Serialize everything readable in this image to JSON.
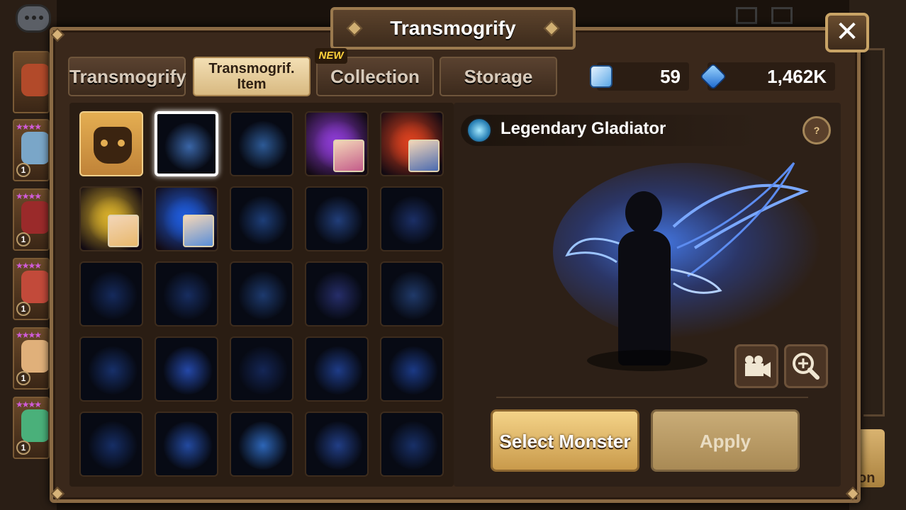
{
  "window": {
    "title": "Transmogrify",
    "close_label": "✕"
  },
  "tabs": [
    {
      "label": "Transmogrify",
      "active": false
    },
    {
      "label": "Transmogrif. Item",
      "active": true
    },
    {
      "label": "Collection",
      "active": false,
      "badge": "NEW"
    },
    {
      "label": "Storage",
      "active": false
    }
  ],
  "currency": {
    "transmogrify_stone": "59",
    "crystals": "1,462K"
  },
  "side_monsters": [
    {
      "stars": "★★★★",
      "level": "1"
    },
    {
      "stars": "★★★★",
      "level": "1"
    },
    {
      "stars": "★★★★",
      "level": "1"
    },
    {
      "stars": "★★★★",
      "level": "1"
    },
    {
      "stars": "★★★★",
      "level": "1"
    }
  ],
  "background_button_text": "on",
  "item_grid": {
    "cells": [
      {
        "kind": "base",
        "glow": "#e4ae52"
      },
      {
        "kind": "effect",
        "glow": "#3a66a8",
        "selected": true
      },
      {
        "kind": "effect",
        "glow": "#2d5a96"
      },
      {
        "kind": "monster",
        "glow": "#8a3ad0",
        "mini": "#c45c8a"
      },
      {
        "kind": "monster",
        "glow": "#d8401e",
        "mini": "#4a6ab0"
      },
      {
        "kind": "monster",
        "glow": "#d4ac2a",
        "mini": "#e8b86c"
      },
      {
        "kind": "monster",
        "glow": "#1e5ad8",
        "mini": "#5a8ed8"
      },
      {
        "kind": "effect",
        "glow": "#1d3e78"
      },
      {
        "kind": "effect",
        "glow": "#213e7a"
      },
      {
        "kind": "effect",
        "glow": "#1b2f66"
      },
      {
        "kind": "effect",
        "glow": "#152a5c"
      },
      {
        "kind": "effect",
        "glow": "#172d60"
      },
      {
        "kind": "effect",
        "glow": "#1d3a6e"
      },
      {
        "kind": "effect",
        "glow": "#262e6a"
      },
      {
        "kind": "effect",
        "glow": "#203a6a"
      },
      {
        "kind": "effect",
        "glow": "#17306a"
      },
      {
        "kind": "effect",
        "glow": "#2448a8"
      },
      {
        "kind": "effect",
        "glow": "#142656"
      },
      {
        "kind": "effect",
        "glow": "#1e3c88"
      },
      {
        "kind": "effect",
        "glow": "#1b3a86"
      },
      {
        "kind": "effect",
        "glow": "#162e66"
      },
      {
        "kind": "effect",
        "glow": "#234aa0"
      },
      {
        "kind": "effect",
        "glow": "#2d66b8"
      },
      {
        "kind": "effect",
        "glow": "#213e86"
      },
      {
        "kind": "effect",
        "glow": "#183068"
      }
    ]
  },
  "preview": {
    "item_name": "Legendary Gladiator",
    "help_label": "?",
    "buttons": {
      "select_monster": "Select Monster",
      "apply": "Apply"
    }
  },
  "icons": {
    "close": "close-icon",
    "help": "gift-help-icon",
    "video": "video-camera-icon",
    "zoom": "zoom-in-icon",
    "stone": "transmogrify-stone-icon",
    "crystal": "crystal-icon"
  }
}
